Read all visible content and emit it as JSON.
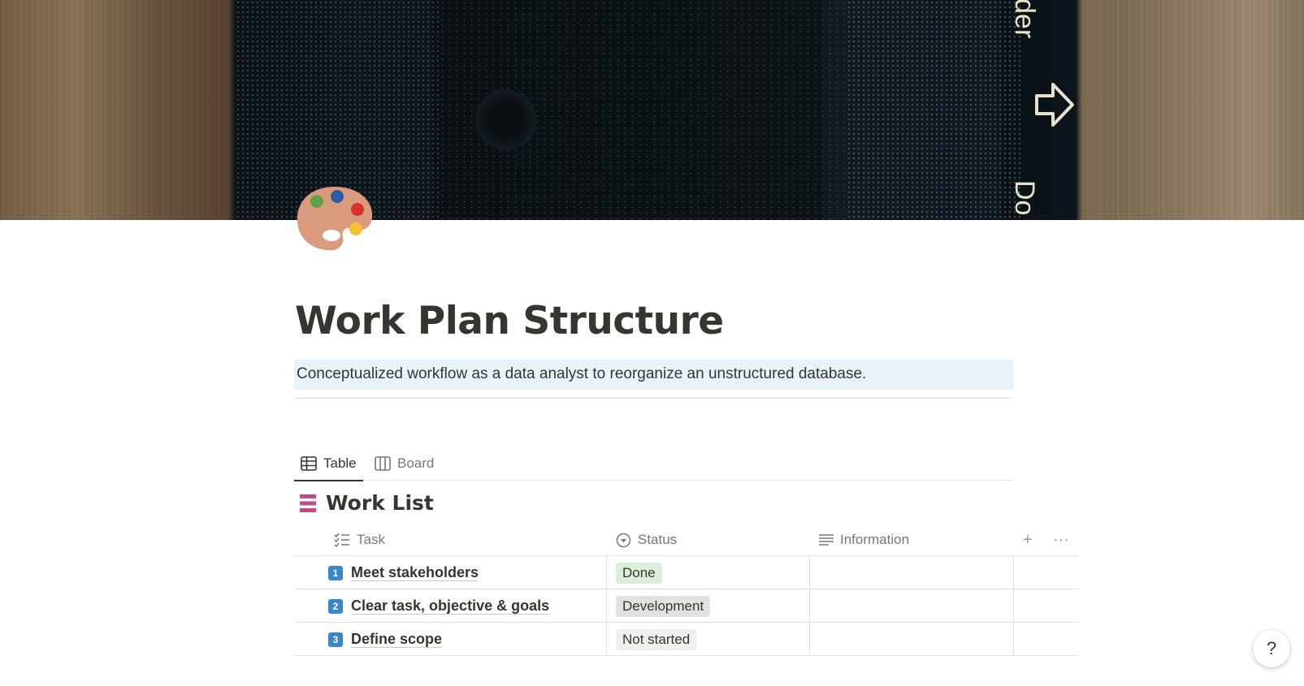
{
  "cover": {
    "side_text_top": "der",
    "side_text_bottom": "Do"
  },
  "page": {
    "icon": "artist-palette-icon",
    "title": "Work Plan Structure",
    "description": "Conceptualized workflow as a data analyst to reorganize an unstructured database."
  },
  "views": {
    "tabs": [
      {
        "label": "Table",
        "icon": "table-icon",
        "active": true
      },
      {
        "label": "Board",
        "icon": "board-icon",
        "active": false
      }
    ]
  },
  "database": {
    "title": "Work List",
    "icon": "list-icon",
    "icon_color": "#c14c8a",
    "columns": [
      {
        "label": "Task",
        "icon": "checklist-icon"
      },
      {
        "label": "Status",
        "icon": "status-circle-icon"
      },
      {
        "label": "Information",
        "icon": "text-lines-icon"
      }
    ],
    "add_column_label": "+",
    "more_label": "···",
    "rows": [
      {
        "number": "1",
        "task": "Meet stakeholders",
        "status": "Done",
        "status_color": "#dbeddb",
        "information": ""
      },
      {
        "number": "2",
        "task": "Clear task, objective & goals",
        "status": "Development",
        "status_color": "#e3e2e0",
        "information": ""
      },
      {
        "number": "3",
        "task": "Define scope",
        "status": "Not started",
        "status_color": "#efefed",
        "information": ""
      }
    ]
  },
  "help": {
    "label": "?"
  }
}
